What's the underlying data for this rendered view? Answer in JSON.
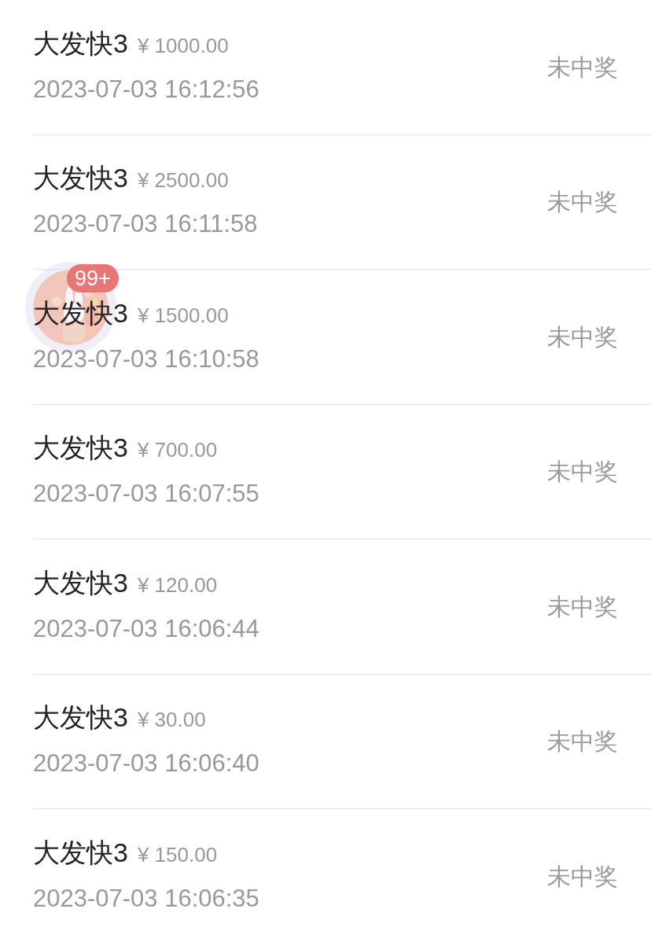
{
  "records": [
    {
      "game": "大发快3",
      "amount": "¥ 1000.00",
      "time": "2023-07-03 16:12:56",
      "status": "未中奖"
    },
    {
      "game": "大发快3",
      "amount": "¥ 2500.00",
      "time": "2023-07-03 16:11:58",
      "status": "未中奖"
    },
    {
      "game": "大发快3",
      "amount": "¥ 1500.00",
      "time": "2023-07-03 16:10:58",
      "status": "未中奖"
    },
    {
      "game": "大发快3",
      "amount": "¥ 700.00",
      "time": "2023-07-03 16:07:55",
      "status": "未中奖"
    },
    {
      "game": "大发快3",
      "amount": "¥ 120.00",
      "time": "2023-07-03 16:06:44",
      "status": "未中奖"
    },
    {
      "game": "大发快3",
      "amount": "¥ 30.00",
      "time": "2023-07-03 16:06:40",
      "status": "未中奖"
    },
    {
      "game": "大发快3",
      "amount": "¥ 150.00",
      "time": "2023-07-03 16:06:35",
      "status": "未中奖"
    }
  ],
  "floating_button": {
    "badge": "99+"
  }
}
